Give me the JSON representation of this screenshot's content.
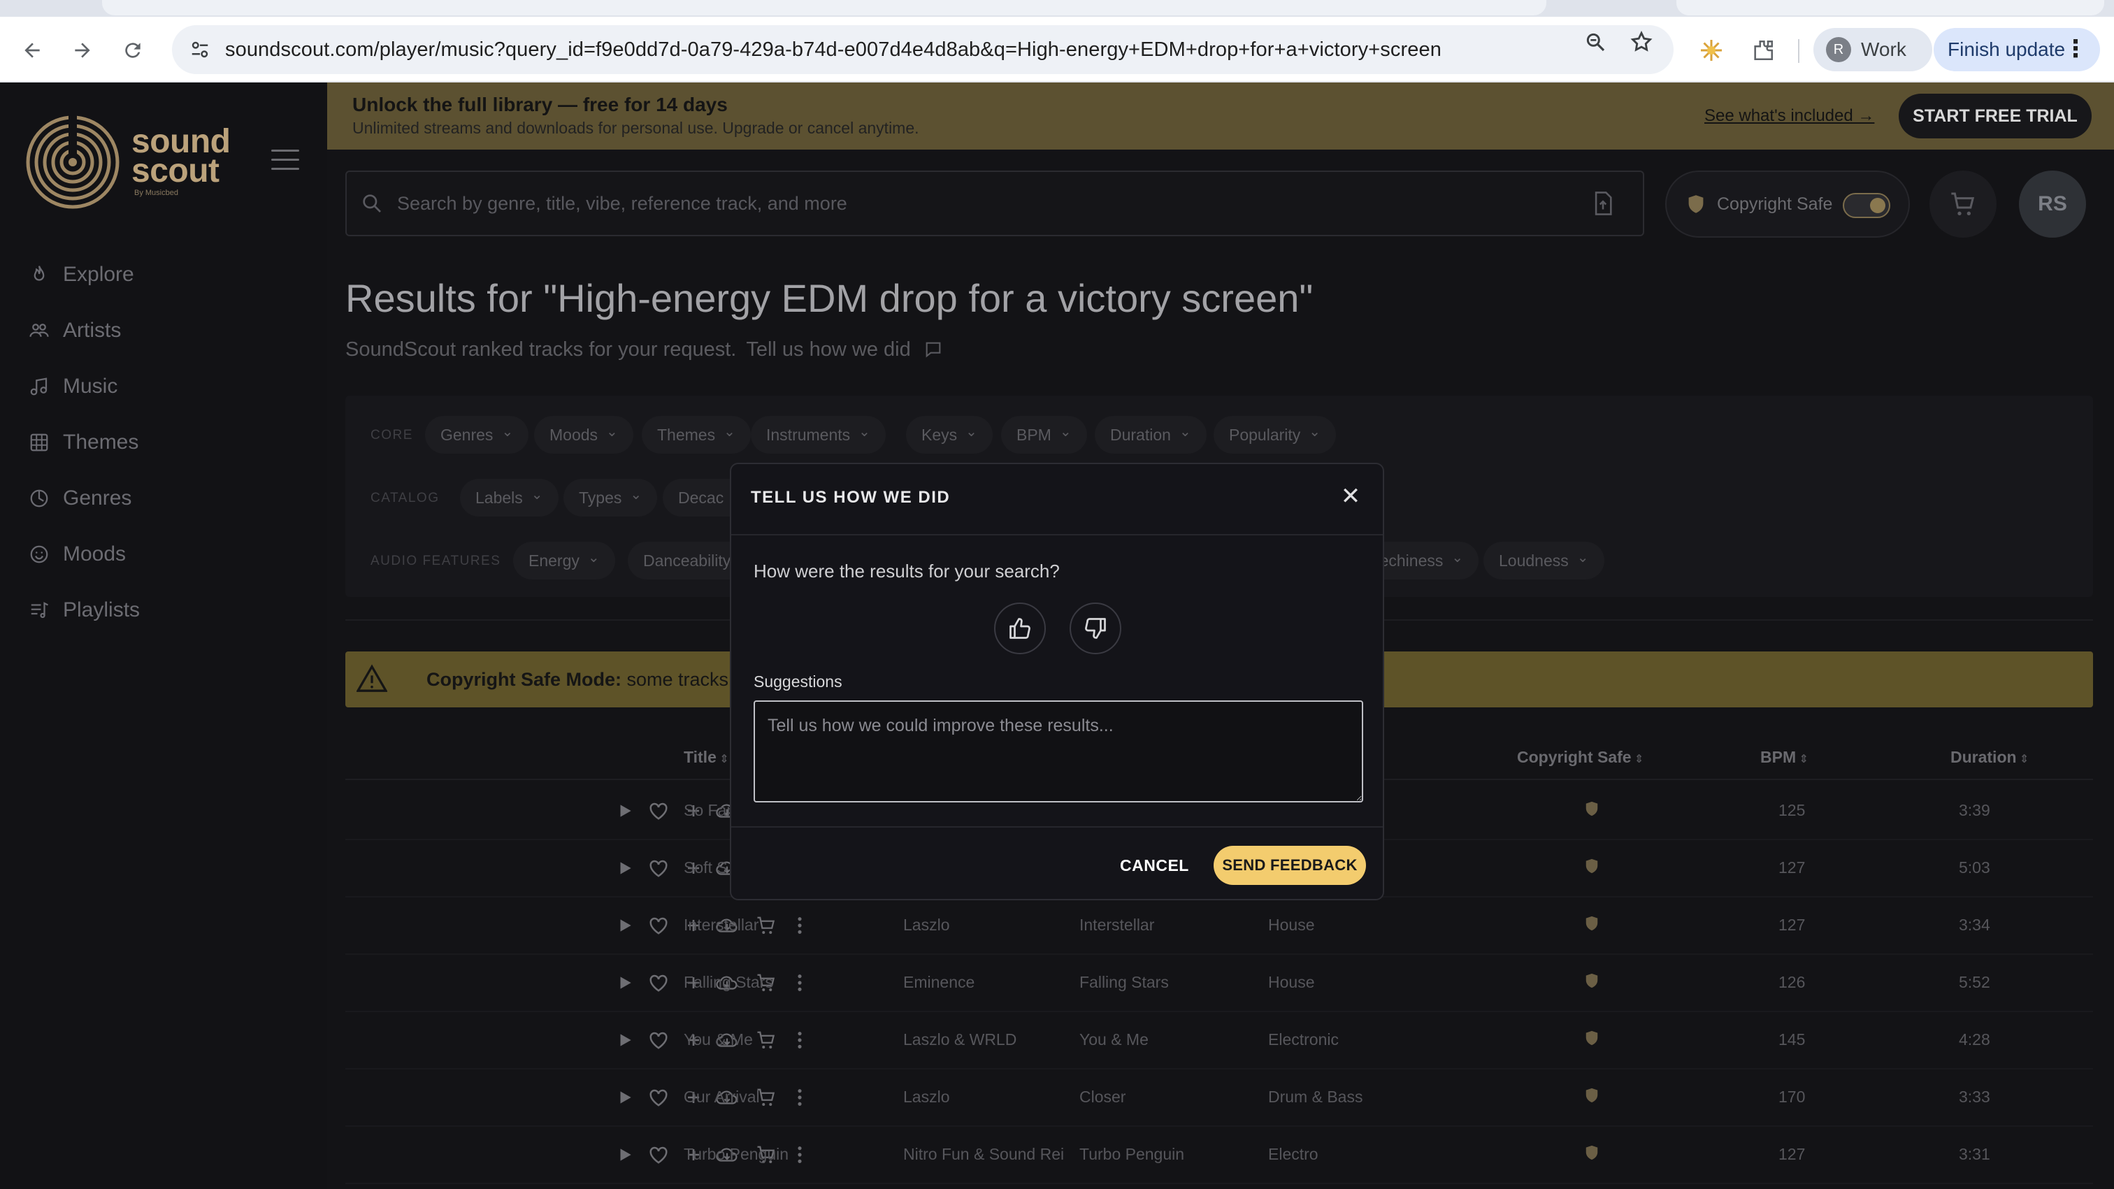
{
  "browser": {
    "url": "soundscout.com/player/music?query_id=f9e0dd7d-0a79-429a-b74d-e007d4e4d8ab&q=High-energy+EDM+drop+for+a+victory+screen",
    "profile_initial": "R",
    "profile_label": "Work",
    "update_label": "Finish update"
  },
  "sidebar": {
    "logo_line1": "sound",
    "logo_line2": "scout",
    "logo_sub": "By Musicbed",
    "items": [
      {
        "label": "Explore",
        "icon": "flame-icon"
      },
      {
        "label": "Artists",
        "icon": "people-icon"
      },
      {
        "label": "Music",
        "icon": "music-note-icon"
      },
      {
        "label": "Themes",
        "icon": "grid-icon"
      },
      {
        "label": "Genres",
        "icon": "disc-icon"
      },
      {
        "label": "Moods",
        "icon": "smile-icon"
      },
      {
        "label": "Playlists",
        "icon": "playlist-icon"
      }
    ]
  },
  "promo": {
    "title": "Unlock the full library — free for 14 days",
    "subtitle": "Unlimited streams and downloads for personal use. Upgrade or cancel anytime.",
    "link": "See what's included →",
    "cta": "START FREE TRIAL"
  },
  "search": {
    "placeholder": "Search by genre, title, vibe, reference track, and more"
  },
  "copyright_toggle": {
    "label": "Copyright Safe",
    "enabled": true
  },
  "user": {
    "initials": "RS"
  },
  "results": {
    "title": "Results for \"High-energy EDM drop for a victory screen\"",
    "subtitle": "SoundScout ranked tracks for your request.",
    "tell_link": "Tell us how we did"
  },
  "filters": {
    "core_label": "CORE",
    "core": [
      "Genres",
      "Moods",
      "Themes",
      "Instruments",
      "Keys",
      "BPM",
      "Duration",
      "Popularity"
    ],
    "catalog_label": "CATALOG",
    "catalog": [
      "Labels",
      "Types",
      "Decac"
    ],
    "audio_label": "AUDIO FEATURES",
    "audio": [
      "Energy",
      "Danceability",
      "peechiness",
      "Loudness"
    ]
  },
  "warning": {
    "bold": "Copyright Safe Mode:",
    "text": " some tracks m"
  },
  "table": {
    "headers": {
      "title": "Title",
      "copyright": "Copyright Safe",
      "bpm": "BPM",
      "duration": "Duration"
    },
    "rows": [
      {
        "title": "So Far",
        "artist": "",
        "album": "",
        "genre": "",
        "bpm": "125",
        "duration": "3:39"
      },
      {
        "title": "Soft S",
        "artist": "",
        "album": "",
        "genre": "",
        "bpm": "127",
        "duration": "5:03"
      },
      {
        "title": "Interstellar",
        "artist": "Laszlo",
        "album": "Interstellar",
        "genre": "House",
        "bpm": "127",
        "duration": "3:34"
      },
      {
        "title": "Falling Stars",
        "artist": "Eminence",
        "album": "Falling Stars",
        "genre": "House",
        "bpm": "126",
        "duration": "5:52"
      },
      {
        "title": "You & Me",
        "artist": "Laszlo & WRLD",
        "album": "You & Me",
        "genre": "Electronic",
        "bpm": "145",
        "duration": "4:28"
      },
      {
        "title": "Our Arrival",
        "artist": "Laszlo",
        "album": "Closer",
        "genre": "Drum & Bass",
        "bpm": "170",
        "duration": "3:33"
      },
      {
        "title": "Turbo Penguin",
        "artist": "Nitro Fun & Sound Rei",
        "album": "Turbo Penguin",
        "genre": "Electro",
        "bpm": "127",
        "duration": "3:31"
      }
    ]
  },
  "modal": {
    "title": "TELL US HOW WE DID",
    "question": "How were the results for your search?",
    "suggestions_label": "Suggestions",
    "suggestions_placeholder": "Tell us how we could improve these results...",
    "cancel": "CANCEL",
    "send": "SEND FEEDBACK"
  },
  "colors": {
    "accent": "#f3cc6e",
    "promo_bg": "#5c5131",
    "warning_bg": "#5e5328"
  }
}
